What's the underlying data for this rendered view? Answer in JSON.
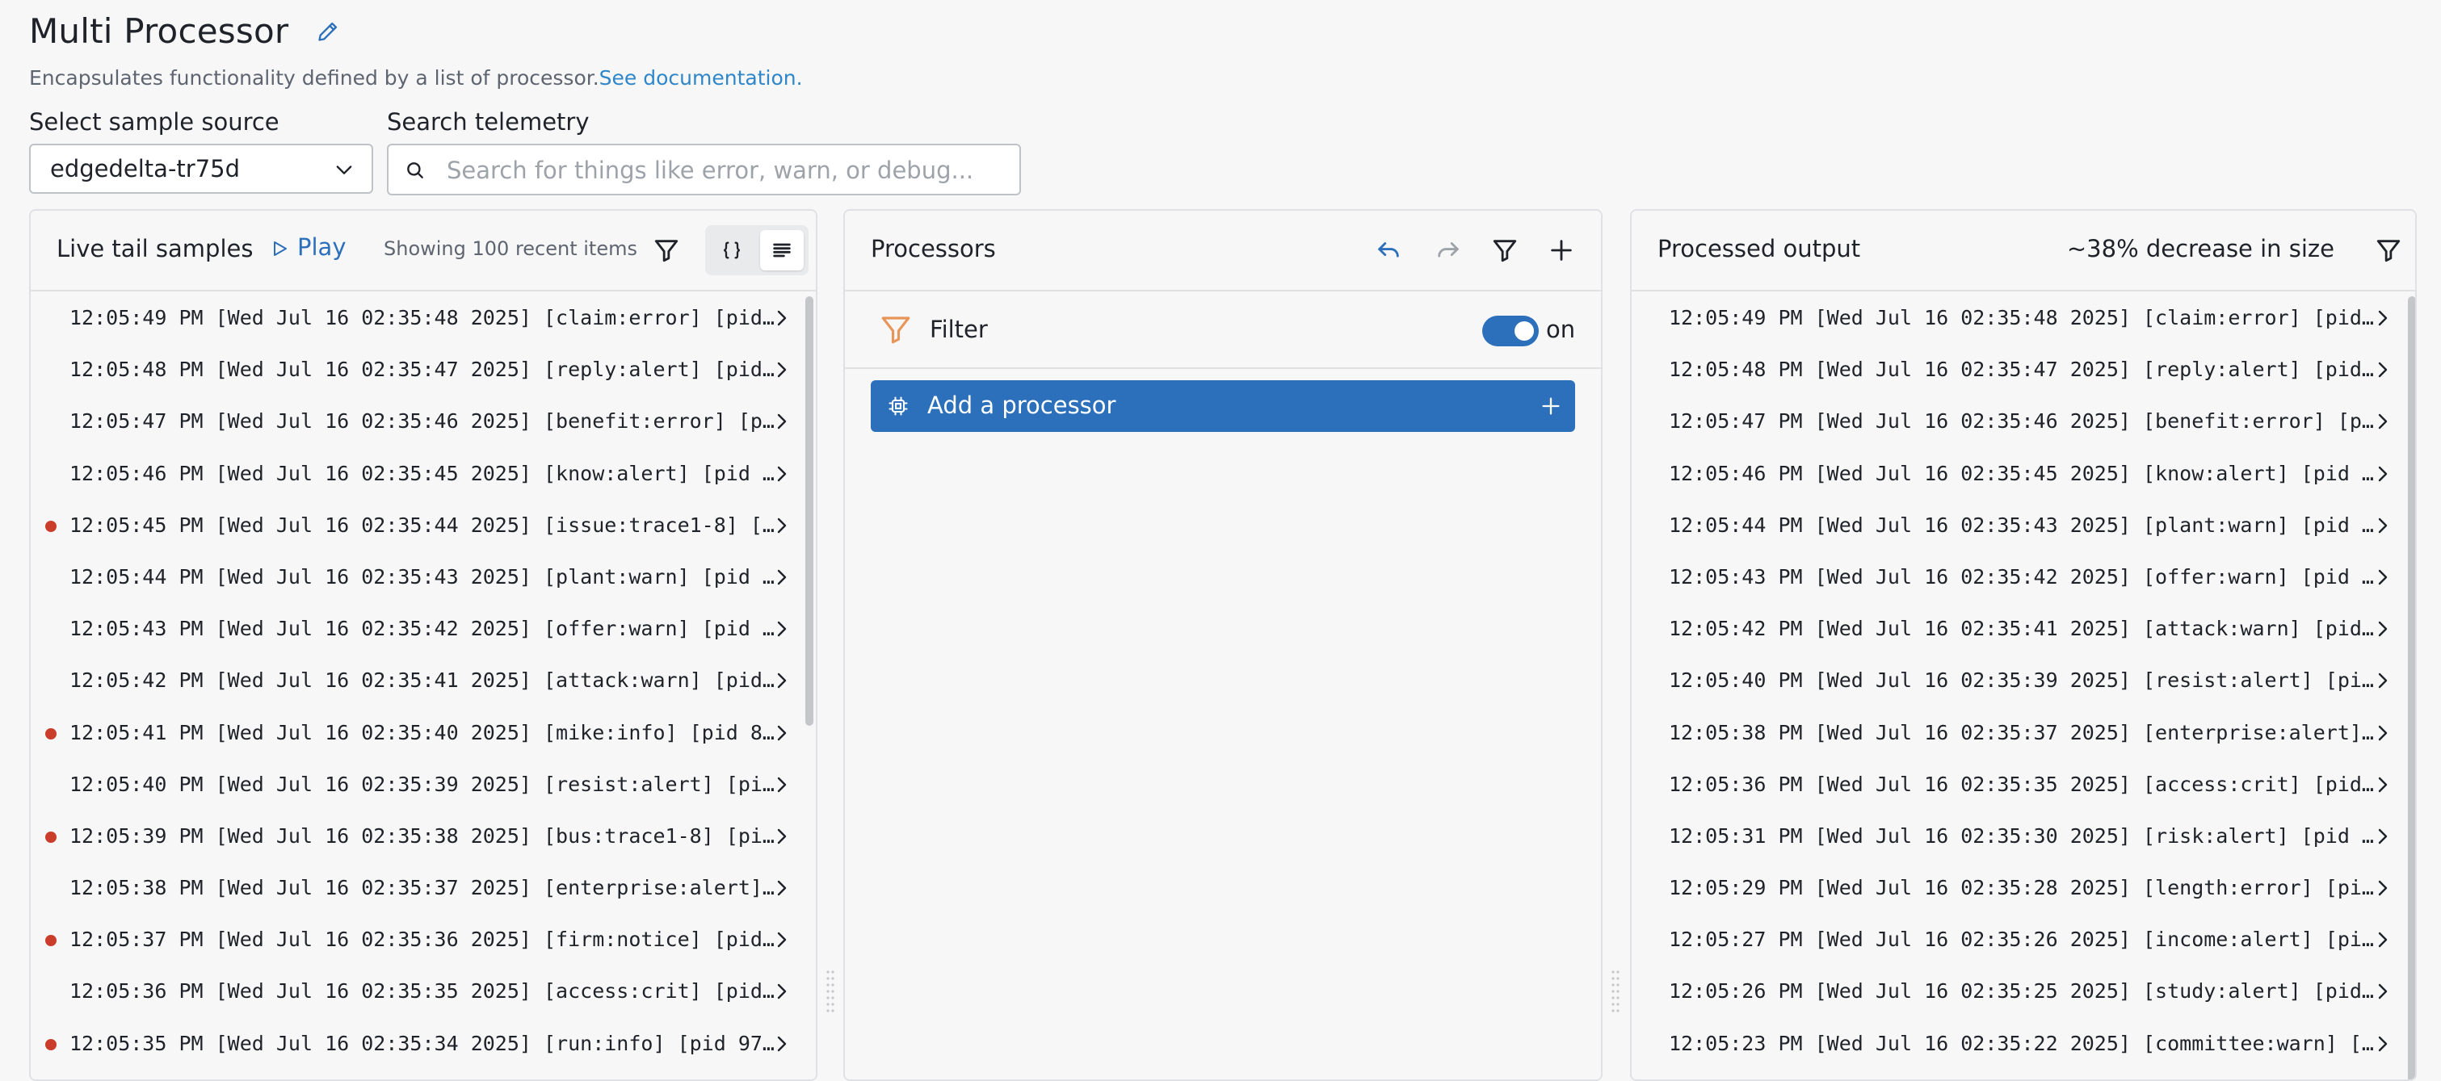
{
  "header": {
    "title": "Multi Processor",
    "description": "Encapsulates functionality defined by a list of processor.",
    "doc_link": "See documentation."
  },
  "sample_source": {
    "label": "Select sample source",
    "value": "edgedelta-tr75d"
  },
  "search": {
    "label": "Search telemetry",
    "placeholder": "Search for things like error, warn, or debug..."
  },
  "live_tail": {
    "title": "Live tail samples",
    "play_label": "Play",
    "showing": "Showing 100 recent items",
    "rows": [
      {
        "text": "12:05:49 PM [Wed Jul 16 02:35:48 2025] [claim:error] [pid…",
        "flag": false
      },
      {
        "text": "12:05:48 PM [Wed Jul 16 02:35:47 2025] [reply:alert] [pid…",
        "flag": false
      },
      {
        "text": "12:05:47 PM [Wed Jul 16 02:35:46 2025] [benefit:error] [p…",
        "flag": false
      },
      {
        "text": "12:05:46 PM [Wed Jul 16 02:35:45 2025] [know:alert] [pid …",
        "flag": false
      },
      {
        "text": "12:05:45 PM [Wed Jul 16 02:35:44 2025] [issue:trace1-8] […",
        "flag": true
      },
      {
        "text": "12:05:44 PM [Wed Jul 16 02:35:43 2025] [plant:warn] [pid …",
        "flag": false
      },
      {
        "text": "12:05:43 PM [Wed Jul 16 02:35:42 2025] [offer:warn] [pid …",
        "flag": false
      },
      {
        "text": "12:05:42 PM [Wed Jul 16 02:35:41 2025] [attack:warn] [pid…",
        "flag": false
      },
      {
        "text": "12:05:41 PM [Wed Jul 16 02:35:40 2025] [mike:info] [pid 8…",
        "flag": true
      },
      {
        "text": "12:05:40 PM [Wed Jul 16 02:35:39 2025] [resist:alert] [pi…",
        "flag": false
      },
      {
        "text": "12:05:39 PM [Wed Jul 16 02:35:38 2025] [bus:trace1-8] [pi…",
        "flag": true
      },
      {
        "text": "12:05:38 PM [Wed Jul 16 02:35:37 2025] [enterprise:alert]…",
        "flag": false
      },
      {
        "text": "12:05:37 PM [Wed Jul 16 02:35:36 2025] [firm:notice] [pid…",
        "flag": true
      },
      {
        "text": "12:05:36 PM [Wed Jul 16 02:35:35 2025] [access:crit] [pid…",
        "flag": false
      },
      {
        "text": "12:05:35 PM [Wed Jul 16 02:35:34 2025] [run:info] [pid 97…",
        "flag": true
      }
    ]
  },
  "processors": {
    "title": "Processors",
    "filter_label": "Filter",
    "toggle_label": "on",
    "add_label": "Add a processor"
  },
  "output": {
    "title": "Processed output",
    "decrease": "~38% decrease in size",
    "rows": [
      "12:05:49 PM [Wed Jul 16 02:35:48 2025] [claim:error] [pid…",
      "12:05:48 PM [Wed Jul 16 02:35:47 2025] [reply:alert] [pid…",
      "12:05:47 PM [Wed Jul 16 02:35:46 2025] [benefit:error] [p…",
      "12:05:46 PM [Wed Jul 16 02:35:45 2025] [know:alert] [pid …",
      "12:05:44 PM [Wed Jul 16 02:35:43 2025] [plant:warn] [pid …",
      "12:05:43 PM [Wed Jul 16 02:35:42 2025] [offer:warn] [pid …",
      "12:05:42 PM [Wed Jul 16 02:35:41 2025] [attack:warn] [pid…",
      "12:05:40 PM [Wed Jul 16 02:35:39 2025] [resist:alert] [pi…",
      "12:05:38 PM [Wed Jul 16 02:35:37 2025] [enterprise:alert]…",
      "12:05:36 PM [Wed Jul 16 02:35:35 2025] [access:crit] [pid…",
      "12:05:31 PM [Wed Jul 16 02:35:30 2025] [risk:alert] [pid …",
      "12:05:29 PM [Wed Jul 16 02:35:28 2025] [length:error] [pi…",
      "12:05:27 PM [Wed Jul 16 02:35:26 2025] [income:alert] [pi…",
      "12:05:26 PM [Wed Jul 16 02:35:25 2025] [study:alert] [pid…",
      "12:05:23 PM [Wed Jul 16 02:35:22 2025] [committee:warn] […"
    ]
  },
  "colors": {
    "accent": "#2c6fba",
    "link": "#2f86c9",
    "flag": "#c93d2a",
    "filter_icon": "#e8955a"
  }
}
